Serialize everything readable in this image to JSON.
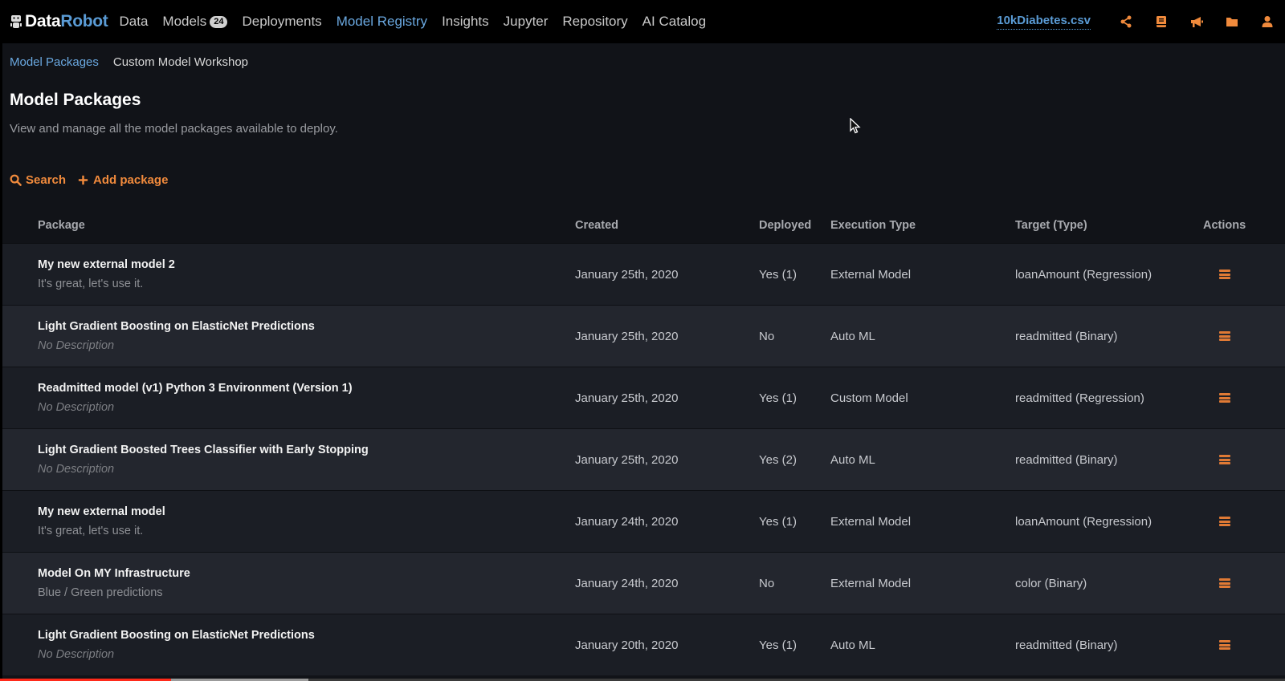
{
  "brand": {
    "part1": "Data",
    "part2": "Robot"
  },
  "nav": {
    "items": [
      {
        "label": "Data",
        "active": false
      },
      {
        "label": "Models",
        "badge": "24",
        "active": false
      },
      {
        "label": "Deployments",
        "active": false
      },
      {
        "label": "Model Registry",
        "active": true
      },
      {
        "label": "Insights",
        "active": false
      },
      {
        "label": "Jupyter",
        "active": false
      },
      {
        "label": "Repository",
        "active": false
      },
      {
        "label": "AI Catalog",
        "active": false
      }
    ],
    "dataset": "10kDiabetes.csv",
    "icons": [
      "share-icon",
      "book-icon",
      "megaphone-icon",
      "folder-icon",
      "user-icon"
    ]
  },
  "breadcrumbs": [
    "Model Packages",
    "Custom Model Workshop"
  ],
  "page": {
    "title": "Model Packages",
    "subtitle": "View and manage all the model packages available to deploy."
  },
  "actions": {
    "search": "Search",
    "add": "Add package"
  },
  "table": {
    "headers": {
      "package": "Package",
      "created": "Created",
      "deployed": "Deployed",
      "execution_type": "Execution Type",
      "target": "Target (Type)",
      "actions": "Actions"
    },
    "rows": [
      {
        "name": "My new external model 2",
        "description": "It's great, let's use it.",
        "no_desc": false,
        "created": "January 25th, 2020",
        "deployed": "Yes (1)",
        "execution_type": "External Model",
        "target": "loanAmount (Regression)"
      },
      {
        "name": "Light Gradient Boosting on ElasticNet Predictions",
        "description": "No Description",
        "no_desc": true,
        "created": "January 25th, 2020",
        "deployed": "No",
        "execution_type": "Auto ML",
        "target": "readmitted (Binary)"
      },
      {
        "name": "Readmitted model (v1) Python 3 Environment (Version 1)",
        "description": "No Description",
        "no_desc": true,
        "created": "January 25th, 2020",
        "deployed": "Yes (1)",
        "execution_type": "Custom Model",
        "target": "readmitted (Regression)"
      },
      {
        "name": "Light Gradient Boosted Trees Classifier with Early Stopping",
        "description": "No Description",
        "no_desc": true,
        "created": "January 25th, 2020",
        "deployed": "Yes (2)",
        "execution_type": "Auto ML",
        "target": "readmitted (Binary)"
      },
      {
        "name": "My new external model",
        "description": "It's great, let's use it.",
        "no_desc": false,
        "created": "January 24th, 2020",
        "deployed": "Yes (1)",
        "execution_type": "External Model",
        "target": "loanAmount (Regression)"
      },
      {
        "name": "Model On MY Infrastructure",
        "description": "Blue / Green predictions",
        "no_desc": false,
        "created": "January 24th, 2020",
        "deployed": "No",
        "execution_type": "External Model",
        "target": "color (Binary)"
      },
      {
        "name": "Light Gradient Boosting on ElasticNet Predictions",
        "description": "No Description",
        "no_desc": true,
        "created": "January 20th, 2020",
        "deployed": "Yes (1)",
        "execution_type": "Auto ML",
        "target": "readmitted (Binary)"
      }
    ]
  },
  "video_progress": {
    "played_fraction": 0.133,
    "buffered_fraction": 0.24
  },
  "colors": {
    "accent": "#f08a3c",
    "link": "#6aa8e0",
    "background": "#111318"
  }
}
